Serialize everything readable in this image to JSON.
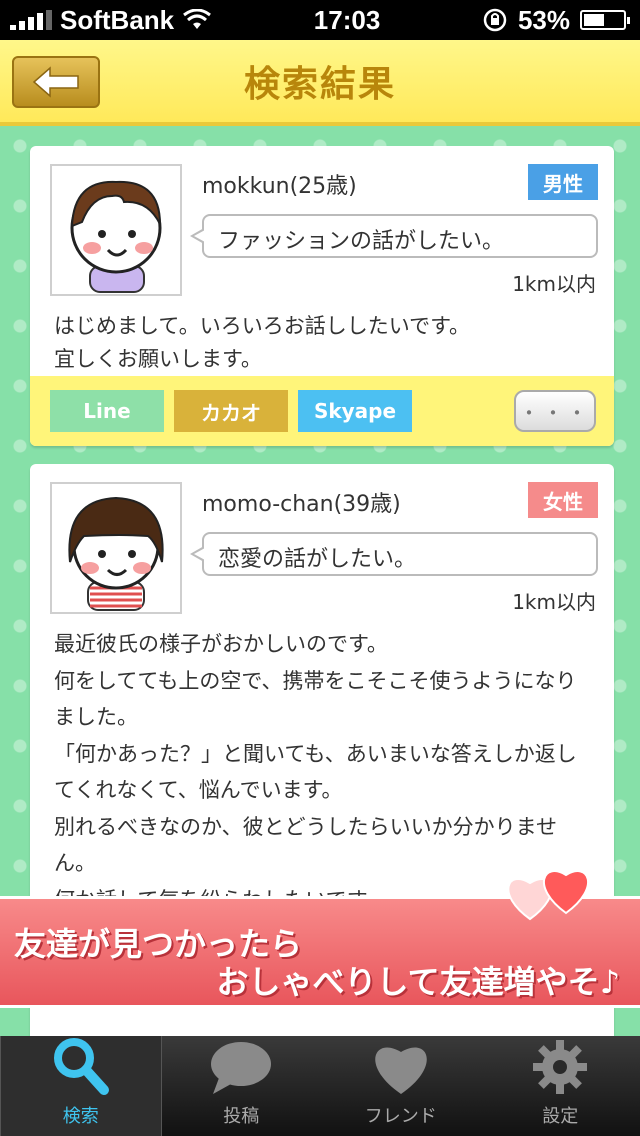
{
  "status_bar": {
    "carrier": "SoftBank",
    "time": "17:03",
    "battery": "53%",
    "battery_fraction": 0.53
  },
  "header": {
    "title": "検索結果",
    "back_icon": "left-arrow-icon"
  },
  "cards": [
    {
      "username": "mokkun(25歳)",
      "gender": "男性",
      "topic": "ファッションの話がしたい。",
      "distance": "1km以内",
      "message": "はじめまして。いろいろお話ししたいです。\n宜しくお願いします。",
      "sns": [
        "Line",
        "カカオ",
        "Skyape"
      ],
      "more": "・・・"
    },
    {
      "username": "momo-chan(39歳)",
      "gender": "女性",
      "topic": "恋愛の話がしたい。",
      "distance": "1km以内",
      "message": "最近彼氏の様子がおかしいのです。\n何をしてても上の空で、携帯をこそこそ使うようになりました。\n「何かあった？」と聞いても、あいまいな答えしか返してくれなくて、悩んでいます。\n別れるべきなのか、彼とどうしたらいいか分かりません。\n何か話して気を紛らわしたいです〜"
    }
  ],
  "banner": {
    "line1": "友達が見つかったら",
    "line2": "おしゃべりして友達増やそ♪"
  },
  "tabs": [
    {
      "label": "検索",
      "icon": "search-icon"
    },
    {
      "label": "投稿",
      "icon": "speech-bubble-icon"
    },
    {
      "label": "フレンド",
      "icon": "heart-icon"
    },
    {
      "label": "設定",
      "icon": "gear-icon"
    }
  ],
  "colors": {
    "header_bg": "#ffe95a",
    "male": "#4aa0e6",
    "female": "#f58b8b",
    "active_tab": "#3fc4ef"
  }
}
